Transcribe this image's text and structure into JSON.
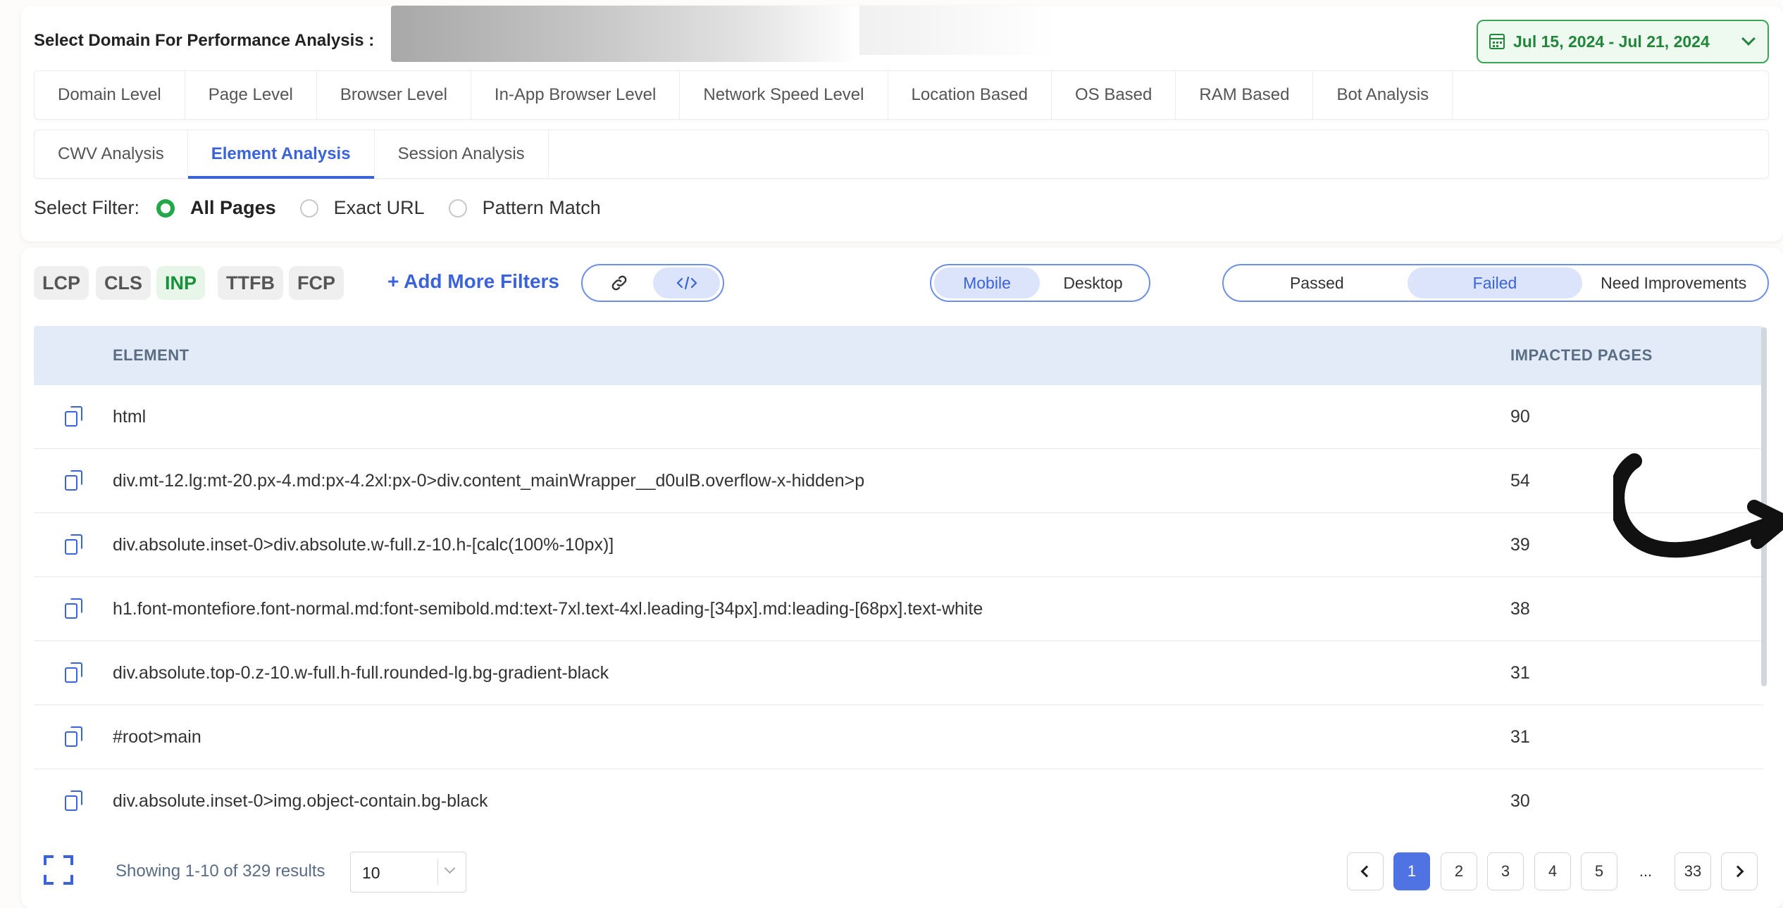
{
  "header": {
    "domain_label": "Select Domain For Performance Analysis :",
    "date_range": "Jul 15, 2024 - Jul 21, 2024"
  },
  "level_tabs": [
    {
      "label": "Domain Level"
    },
    {
      "label": "Page Level"
    },
    {
      "label": "Browser Level"
    },
    {
      "label": "In-App Browser Level"
    },
    {
      "label": "Network Speed Level"
    },
    {
      "label": "Location Based"
    },
    {
      "label": "OS Based"
    },
    {
      "label": "RAM Based"
    },
    {
      "label": "Bot Analysis"
    }
  ],
  "analysis_tabs": [
    {
      "label": "CWV Analysis",
      "active": false
    },
    {
      "label": "Element Analysis",
      "active": true
    },
    {
      "label": "Session Analysis",
      "active": false
    }
  ],
  "filter": {
    "label": "Select Filter:",
    "options": [
      {
        "label": "All Pages",
        "selected": true
      },
      {
        "label": "Exact URL",
        "selected": false
      },
      {
        "label": "Pattern Match",
        "selected": false
      }
    ]
  },
  "metrics": [
    {
      "label": "LCP",
      "active": false
    },
    {
      "label": "CLS",
      "active": false
    },
    {
      "label": "INP",
      "active": true
    },
    {
      "label": "TTFB",
      "active": false
    },
    {
      "label": "FCP",
      "active": false
    }
  ],
  "add_filters_label": "+ Add More Filters",
  "device_toggle": {
    "options": [
      "Mobile",
      "Desktop"
    ],
    "selected": "Mobile"
  },
  "status_toggle": {
    "options": [
      "Passed",
      "Failed",
      "Need Improvements"
    ],
    "selected": "Failed"
  },
  "table": {
    "columns": [
      "ELEMENT",
      "IMPACTED PAGES"
    ],
    "rows": [
      {
        "element": "html",
        "pages": "90"
      },
      {
        "element": "div.mt-12.lg:mt-20.px-4.md:px-4.2xl:px-0>div.content_mainWrapper__d0ulB.overflow-x-hidden>p",
        "pages": "54"
      },
      {
        "element": "div.absolute.inset-0>div.absolute.w-full.z-10.h-[calc(100%-10px)]",
        "pages": "39"
      },
      {
        "element": "h1.font-montefiore.font-normal.md:font-semibold.md:text-7xl.text-4xl.leading-[34px].md:leading-[68px].text-white",
        "pages": "38"
      },
      {
        "element": "div.absolute.top-0.z-10.w-full.h-full.rounded-lg.bg-gradient-black",
        "pages": "31"
      },
      {
        "element": "#root>main",
        "pages": "31"
      },
      {
        "element": "div.absolute.inset-0>img.object-contain.bg-black",
        "pages": "30"
      }
    ]
  },
  "footer": {
    "showing_text": "Showing 1-10 of 329 results",
    "page_size": "10",
    "pages": [
      "1",
      "2",
      "3",
      "4",
      "5",
      "...",
      "33"
    ],
    "current_page": "1"
  },
  "colors": {
    "accent": "#3b63d9",
    "success": "#22a84a",
    "table_header_bg": "#e3ebf8"
  }
}
